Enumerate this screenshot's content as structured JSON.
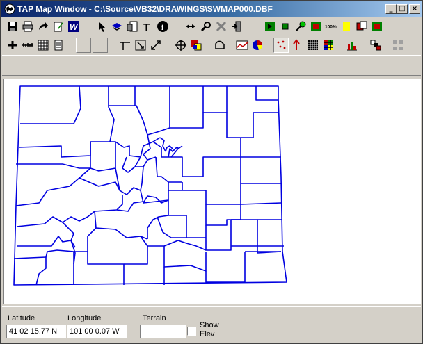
{
  "window": {
    "title": "TAP Map Window - C:\\Source\\VB32\\DRAWINGS\\SWMAP000.DBF",
    "minimize_glyph": "_",
    "maximize_glyph": "□",
    "close_glyph": "×"
  },
  "toolbar_row1": {
    "text_tool_glyph": "T",
    "info_glyph": "i",
    "zoom100_label": "100%"
  },
  "status": {
    "latitude_label": "Latitude",
    "latitude_value": "41 02 15.77 N",
    "longitude_label": "Longitude",
    "longitude_value": "101 00 0.07 W",
    "terrain_label": "Terrain",
    "terrain_value": "",
    "show_elev_label_line1": "Show",
    "show_elev_label_line2": "Elev"
  },
  "colors": {
    "map_lines": "#0000e0",
    "title_bar": "#0a246a",
    "window_face": "#d4d0c8"
  }
}
